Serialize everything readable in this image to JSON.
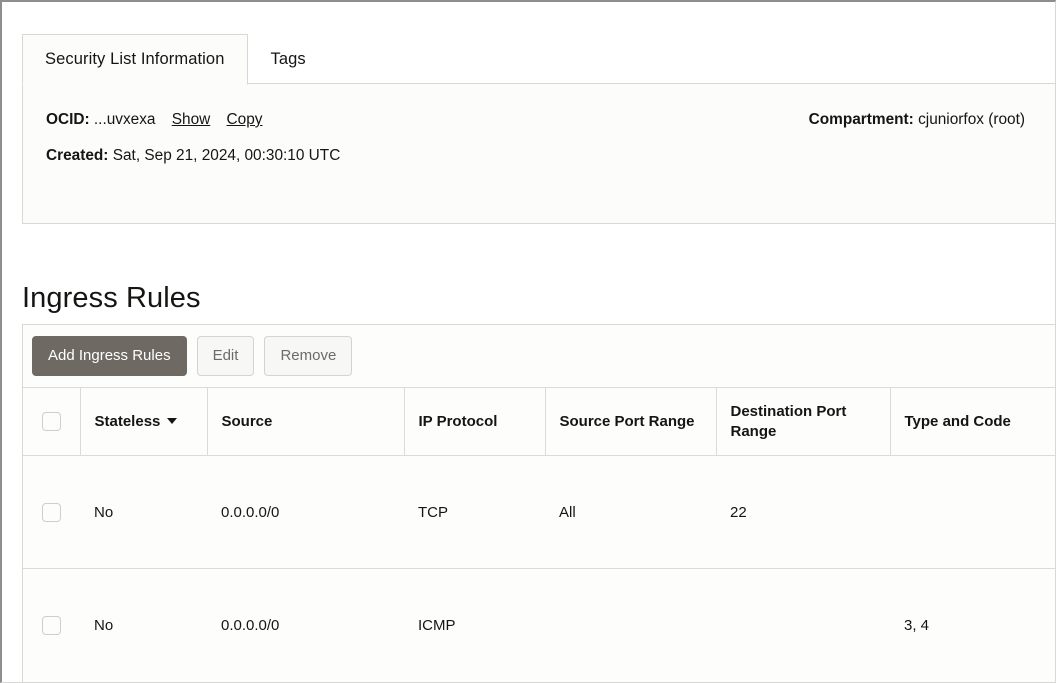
{
  "tabs": [
    {
      "label": "Security List Information",
      "active": true
    },
    {
      "label": "Tags",
      "active": false
    }
  ],
  "details": {
    "ocid_label": "OCID:",
    "ocid_value": "...uvxexa",
    "show_link": "Show",
    "copy_link": "Copy",
    "created_label": "Created:",
    "created_value": "Sat, Sep 21, 2024, 00:30:10 UTC",
    "compartment_label": "Compartment:",
    "compartment_value": "cjuniorfox (root)"
  },
  "section": {
    "title": "Ingress Rules"
  },
  "toolbar": {
    "add_label": "Add Ingress Rules",
    "edit_label": "Edit",
    "remove_label": "Remove"
  },
  "table": {
    "columns": [
      "",
      "Stateless",
      "Source",
      "IP Protocol",
      "Source Port Range",
      "Destination Port Range",
      "Type and Code"
    ],
    "sorted_column": "Stateless",
    "sort_direction": "descending",
    "rows": [
      {
        "stateless": "No",
        "source": "0.0.0.0/0",
        "ip_protocol": "TCP",
        "source_port_range": "All",
        "destination_port_range": "22",
        "type_and_code": ""
      },
      {
        "stateless": "No",
        "source": "0.0.0.0/0",
        "ip_protocol": "ICMP",
        "source_port_range": "",
        "destination_port_range": "",
        "type_and_code": "3, 4"
      }
    ]
  },
  "colors": {
    "primary_button": "#6e6962",
    "panel_background": "#fcfcfb",
    "border": "#d9d8d6"
  }
}
